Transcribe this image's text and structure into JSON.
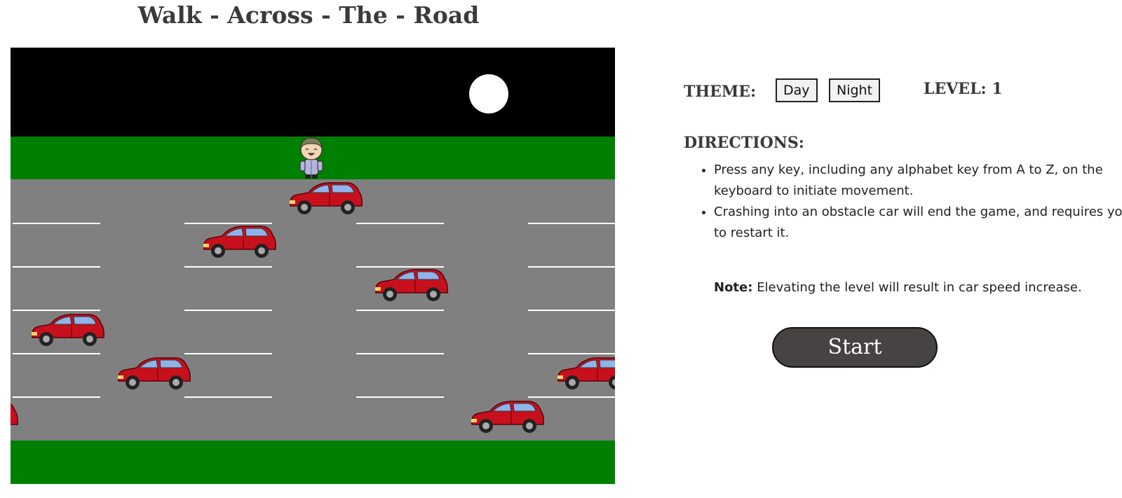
{
  "title": "Walk - Across - The - Road",
  "scene": {
    "theme": "night",
    "colors": {
      "sky": "#000000",
      "moon": "#ffffff",
      "grass": "#008000",
      "road": "#808080",
      "lane_line": "#ffffff",
      "car_body": "#c8101c",
      "car_window": "#8fb3ea"
    }
  },
  "theme": {
    "label": "THEME:",
    "day_label": "Day",
    "night_label": "Night"
  },
  "level": {
    "label": "LEVEL:",
    "value": "1"
  },
  "directions": {
    "heading": "DIRECTIONS:",
    "items": [
      "Press any key, including any alphabet key from A to Z, on the keyboard to initiate movement.",
      "Crashing into an obstacle car will end the game, and requires you to restart it."
    ]
  },
  "note": {
    "label": "Note:",
    "text": "Elevating the level will result in car speed increase."
  },
  "start_label": "Start"
}
